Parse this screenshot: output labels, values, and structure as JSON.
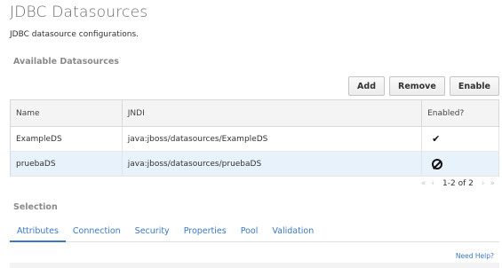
{
  "header": {
    "title": "JDBC Datasources",
    "description": "JDBC datasource configurations."
  },
  "available": {
    "section_title": "Available Datasources",
    "toolbar": {
      "add_label": "Add",
      "remove_label": "Remove",
      "enable_label": "Enable"
    },
    "columns": [
      "Name",
      "JNDI",
      "Enabled?"
    ],
    "rows": [
      {
        "name": "ExampleDS",
        "jndi": "java:jboss/datasources/ExampleDS",
        "enabled_icon": "check-icon",
        "enabled": true
      },
      {
        "name": "pruebaDS",
        "jndi": "java:jboss/datasources/pruebaDS",
        "enabled_icon": "disabled-icon",
        "enabled": false
      }
    ],
    "pager": {
      "range": "1-2 of 2"
    }
  },
  "selection": {
    "section_title": "Selection",
    "tabs": [
      "Attributes",
      "Connection",
      "Security",
      "Properties",
      "Pool",
      "Validation"
    ],
    "active_tab": "Attributes",
    "help_label": "Need Help?"
  },
  "colors": {
    "accent": "#3a78c4",
    "selected_row": "#e8f2fb"
  }
}
